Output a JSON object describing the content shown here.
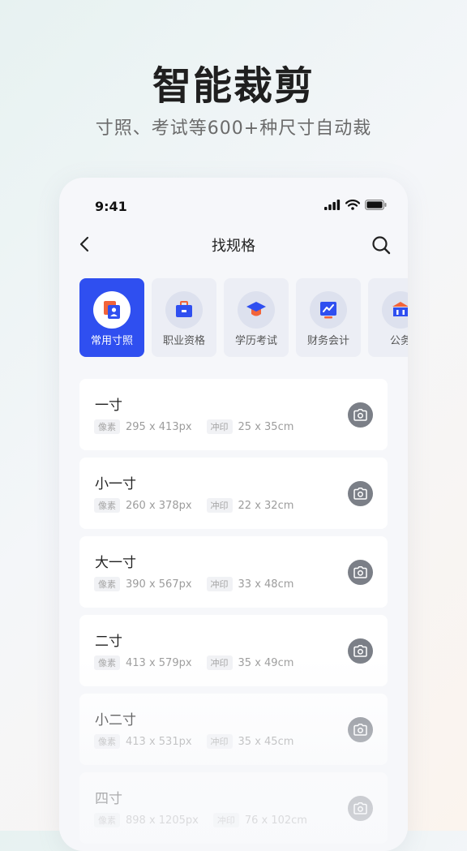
{
  "hero": {
    "title": "智能裁剪",
    "subtitle": "寸照、考试等600+种尺寸自动裁"
  },
  "status_bar": {
    "time": "9:41"
  },
  "nav": {
    "title": "找规格"
  },
  "categories": [
    {
      "label": "常用寸照",
      "icon": "portrait-photo-icon",
      "active": true
    },
    {
      "label": "职业资格",
      "icon": "briefcase-icon",
      "active": false
    },
    {
      "label": "学历考试",
      "icon": "graduation-cap-icon",
      "active": false
    },
    {
      "label": "财务会计",
      "icon": "finance-chart-icon",
      "active": false
    },
    {
      "label": "公务",
      "icon": "government-building-icon",
      "active": false
    }
  ],
  "spec_tags": {
    "pixel": "像素",
    "print": "冲印"
  },
  "sizes": [
    {
      "name": "一寸",
      "pixels": "295 x 413px",
      "print": "25 x 35cm"
    },
    {
      "name": "小一寸",
      "pixels": "260 x 378px",
      "print": "22 x 32cm"
    },
    {
      "name": "大一寸",
      "pixels": "390 x 567px",
      "print": "33 x 48cm"
    },
    {
      "name": "二寸",
      "pixels": "413 x 579px",
      "print": "35 x 49cm"
    },
    {
      "name": "小二寸",
      "pixels": "413 x 531px",
      "print": "35 x 45cm"
    },
    {
      "name": "四寸",
      "pixels": "898 x 1205px",
      "print": "76 x 102cm"
    }
  ],
  "colors": {
    "accent": "#2f4ff0",
    "camera_button": "#7b7f87"
  }
}
